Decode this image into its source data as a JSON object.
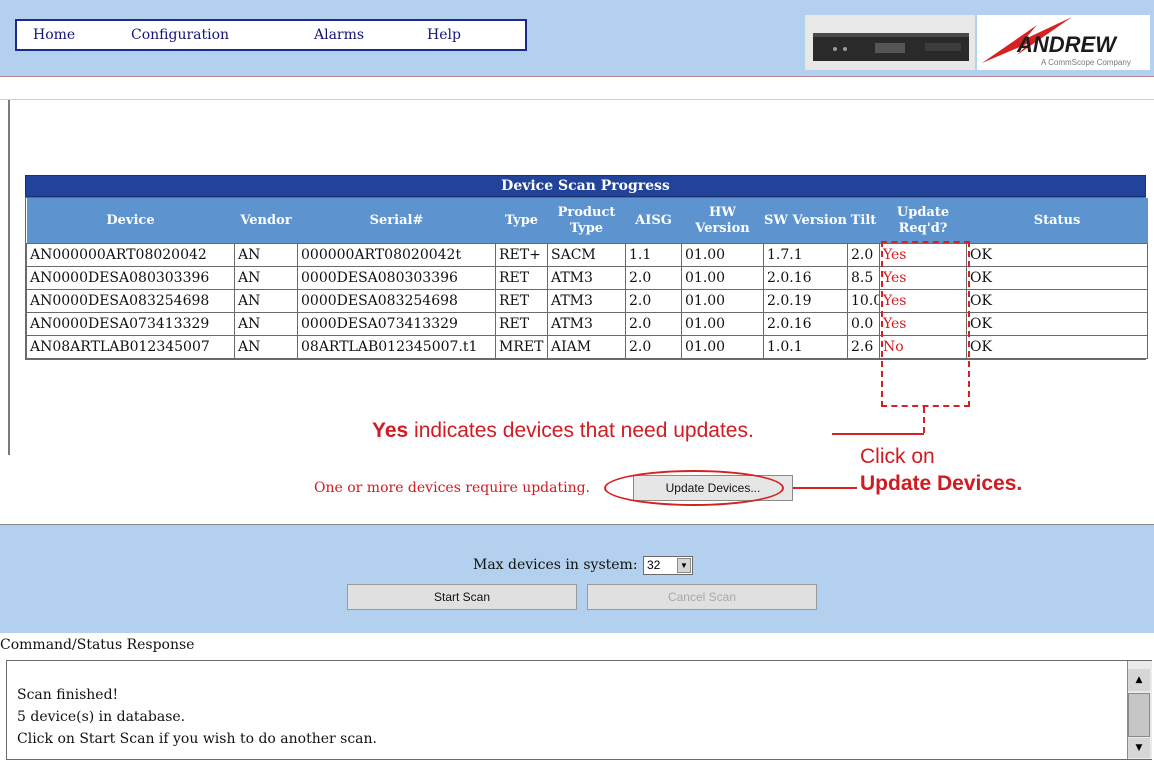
{
  "nav": {
    "home": "Home",
    "configuration": "Configuration",
    "alarms": "Alarms",
    "help": "Help"
  },
  "brand": {
    "name": "ANDREW",
    "tagline": "A CommScope Company",
    "color": "#1c1c1c",
    "accent": "#d72020"
  },
  "scan": {
    "title": "Device Scan Progress",
    "columns": [
      "Device",
      "Vendor",
      "Serial#",
      "Type",
      "Product Type",
      "AISG",
      "HW Version",
      "SW Version",
      "Tilt",
      "Update Req'd?",
      "Status"
    ],
    "rows": [
      [
        "AN000000ART08020042",
        "AN",
        "000000ART08020042t",
        "RET+",
        "SACM",
        "1.1",
        "01.00",
        "1.7.1",
        "2.0",
        "Yes",
        "OK"
      ],
      [
        "AN0000DESA080303396",
        "AN",
        "0000DESA080303396",
        "RET",
        "ATM3",
        "2.0",
        "01.00",
        "2.0.16",
        "8.5",
        "Yes",
        "OK"
      ],
      [
        "AN0000DESA083254698",
        "AN",
        "0000DESA083254698",
        "RET",
        "ATM3",
        "2.0",
        "01.00",
        "2.0.19",
        "10.0",
        "Yes",
        "OK"
      ],
      [
        "AN0000DESA073413329",
        "AN",
        "0000DESA073413329",
        "RET",
        "ATM3",
        "2.0",
        "01.00",
        "2.0.16",
        "0.0",
        "Yes",
        "OK"
      ],
      [
        "AN08ARTLAB012345007",
        "AN",
        "08ARTLAB012345007.t1",
        "MRET",
        "AIAM",
        "2.0",
        "01.00",
        "1.0.1",
        "2.6",
        "No",
        "OK"
      ]
    ]
  },
  "callouts": {
    "yes_bold": "Yes",
    "yes_rest": " indicates devices that need updates.",
    "click_on": "Click on",
    "update_devices": "Update Devices."
  },
  "update": {
    "message": "One or more devices require updating.",
    "button": "Update Devices..."
  },
  "controls": {
    "max_label": "Max devices in system:",
    "max_value": "32",
    "start": "Start Scan",
    "cancel": "Cancel Scan"
  },
  "console": {
    "label": "Command/Status Response",
    "lines": [
      "Scan finished!",
      "5 device(s) in database.",
      "Click on Start Scan if you wish to do another scan."
    ]
  }
}
